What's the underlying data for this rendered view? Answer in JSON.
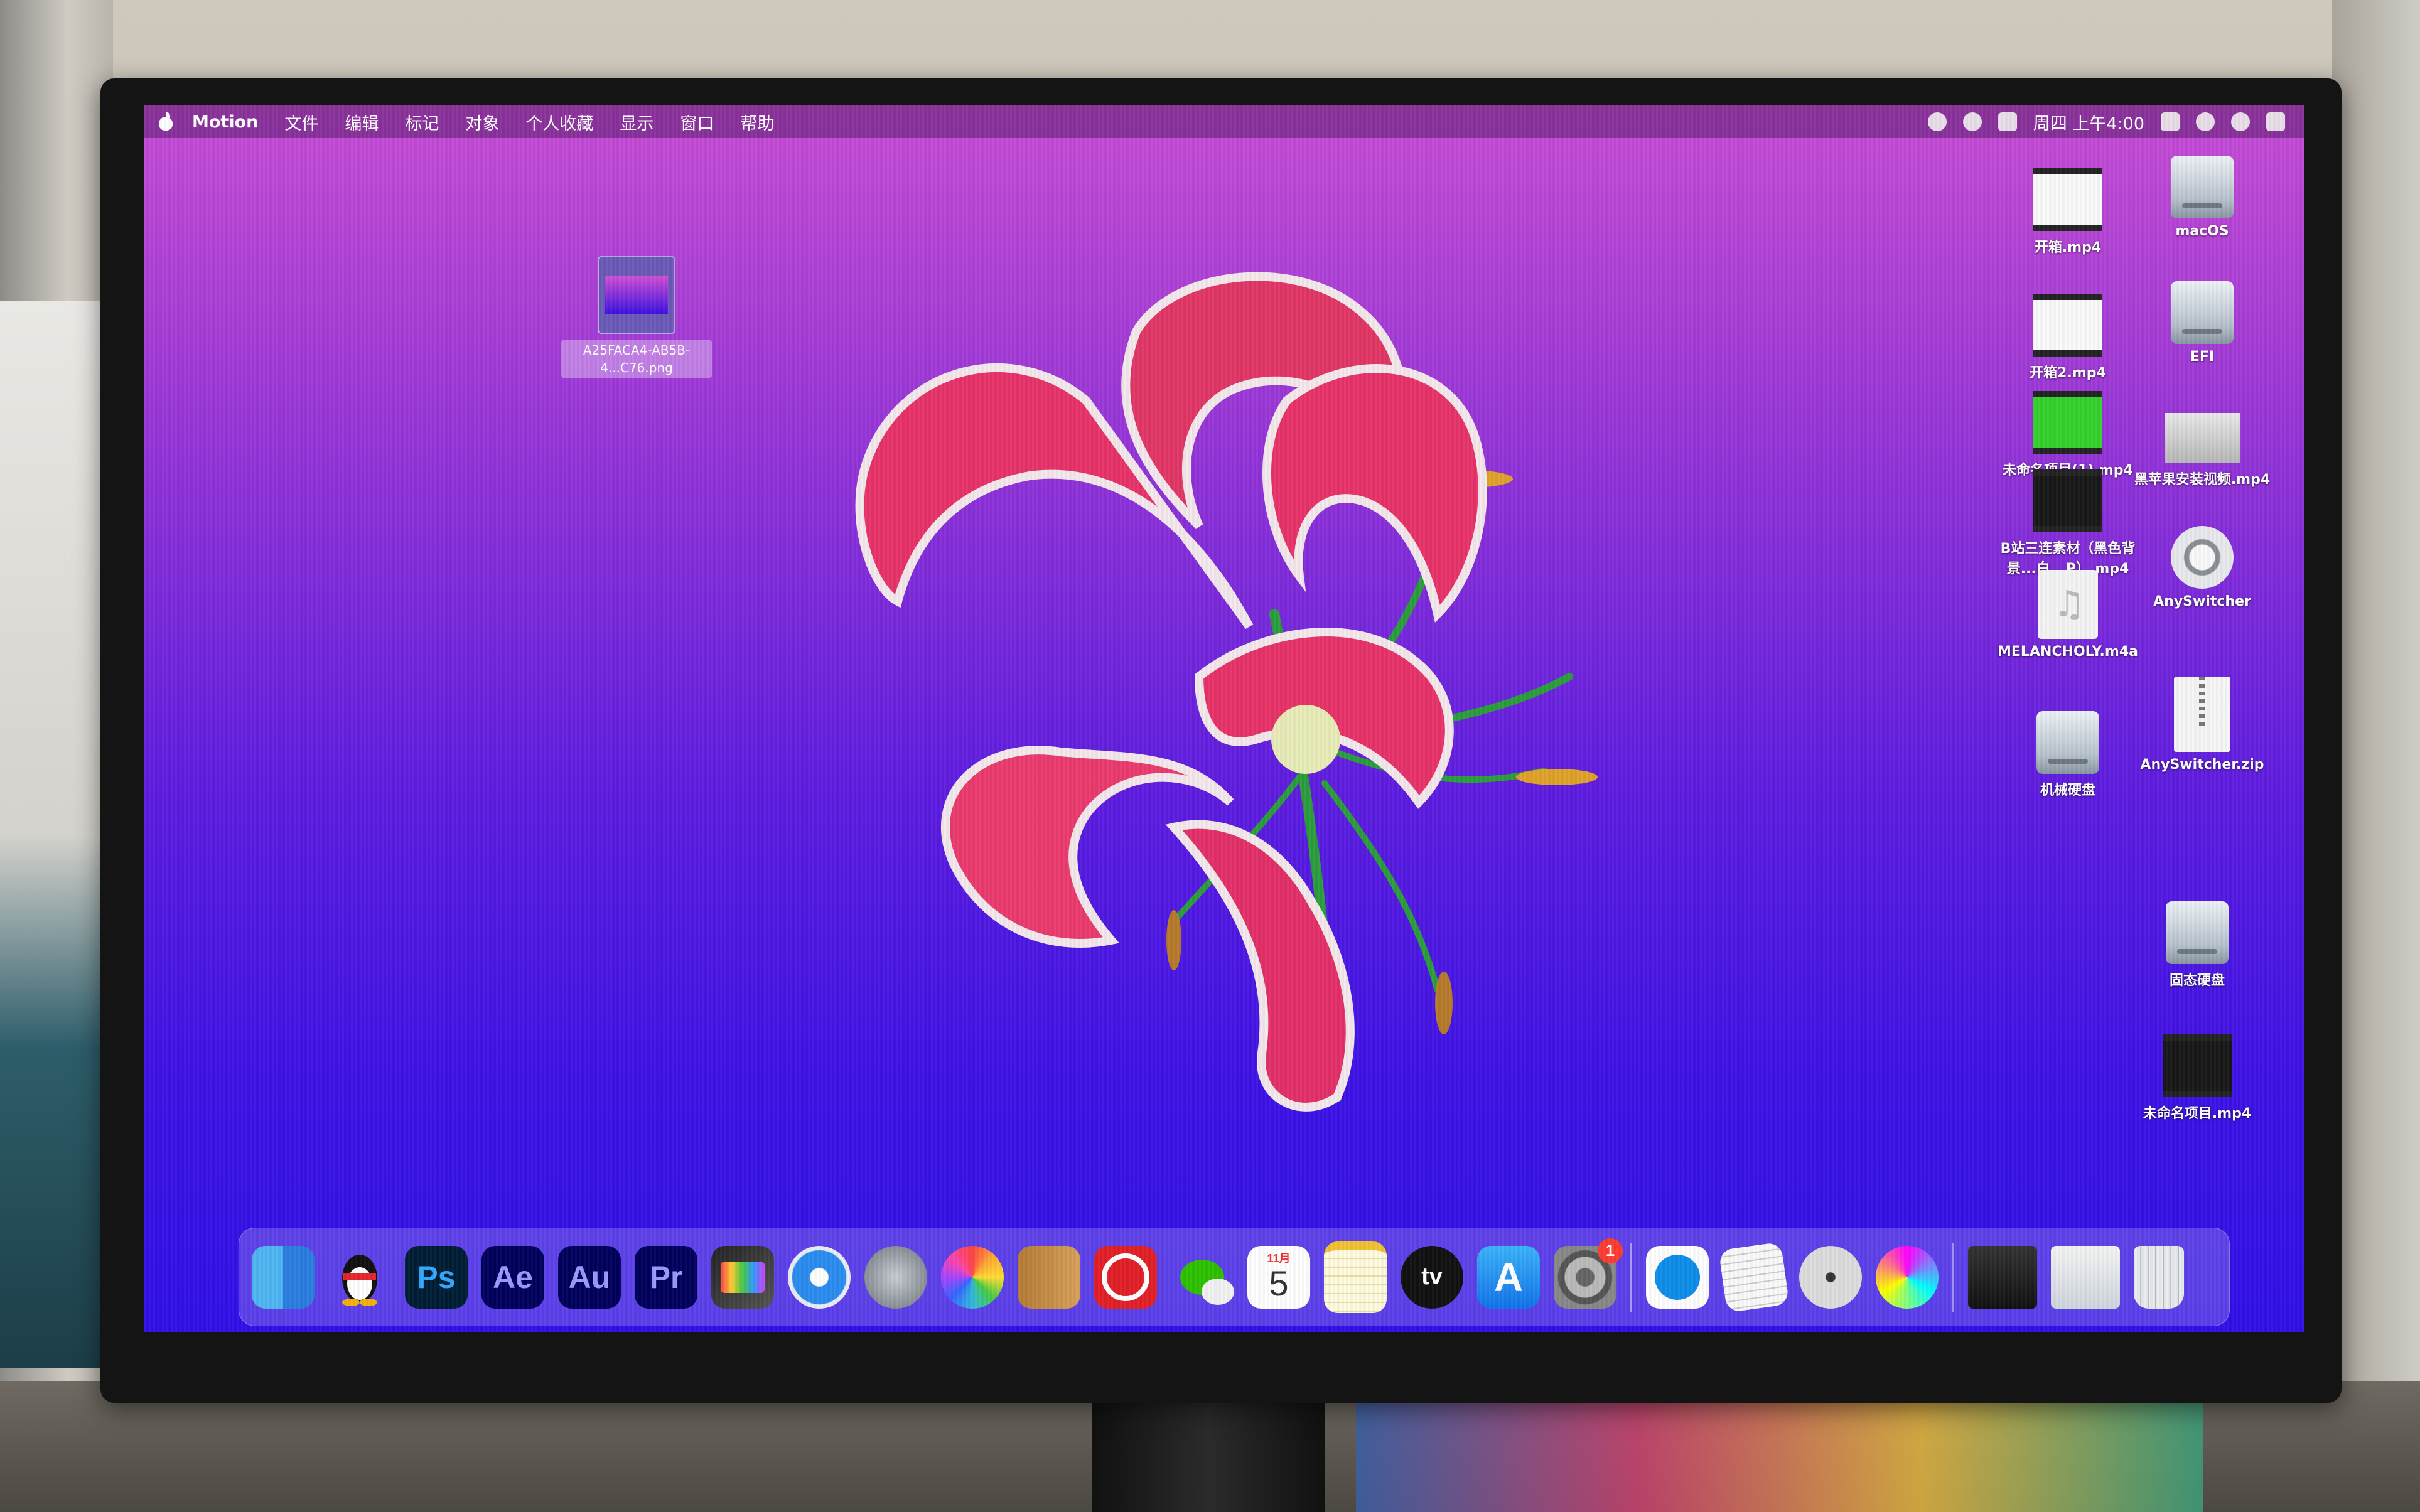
{
  "menubar": {
    "app_name": "Motion",
    "menus": [
      "文件",
      "编辑",
      "标记",
      "对象",
      "个人收藏",
      "显示",
      "窗口",
      "帮助"
    ],
    "clock": "周四 上午4:00"
  },
  "selected_file": {
    "name": "A25FACA4-AB5B-4...C76.png"
  },
  "desktop_icons": [
    {
      "label": "开箱.mp4",
      "kind": "video"
    },
    {
      "label": "macOS",
      "kind": "disk"
    },
    {
      "label": "开箱2.mp4",
      "kind": "video"
    },
    {
      "label": "EFI",
      "kind": "disk"
    },
    {
      "label": "未命名项目(1).mp4",
      "kind": "video-green"
    },
    {
      "label": "黑苹果安装视频.mp4",
      "kind": "video-hack"
    },
    {
      "label": "B站三连素材（黑色背景...白...P）.mp4",
      "kind": "video-dark"
    },
    {
      "label": "AnySwitcher",
      "kind": "app"
    },
    {
      "label": "MELANCHOLY.m4a",
      "kind": "audio"
    },
    {
      "label": "AnySwitcher.zip",
      "kind": "zip"
    },
    {
      "label": "机械硬盘",
      "kind": "disk"
    },
    {
      "label": "固态硬盘",
      "kind": "disk"
    },
    {
      "label": "未命名项目.mp4",
      "kind": "video-dark"
    }
  ],
  "dock": {
    "apps": [
      {
        "name": "finder-icon",
        "label": ""
      },
      {
        "name": "qq-icon",
        "label": ""
      },
      {
        "name": "photoshop-icon",
        "label": "Ps"
      },
      {
        "name": "after-effects-icon",
        "label": "Ae"
      },
      {
        "name": "audition-icon",
        "label": "Au"
      },
      {
        "name": "premiere-pro-icon",
        "label": "Pr"
      },
      {
        "name": "final-cut-pro-icon",
        "label": ""
      },
      {
        "name": "safari-icon",
        "label": ""
      },
      {
        "name": "launchpad-icon",
        "label": ""
      },
      {
        "name": "photos-icon",
        "label": ""
      },
      {
        "name": "contacts-icon",
        "label": ""
      },
      {
        "name": "netease-music-icon",
        "label": ""
      },
      {
        "name": "wechat-icon",
        "label": ""
      },
      {
        "name": "calendar-icon",
        "label": "5",
        "month": "11月"
      },
      {
        "name": "notes-icon",
        "label": ""
      },
      {
        "name": "apple-tv-icon",
        "label": "tv"
      },
      {
        "name": "app-store-icon",
        "label": ""
      },
      {
        "name": "system-preferences-icon",
        "label": "",
        "badge": "1"
      }
    ],
    "right_apps": [
      {
        "name": "teamviewer-icon"
      },
      {
        "name": "textedit-icon"
      },
      {
        "name": "dvd-player-icon"
      },
      {
        "name": "motion-icon"
      }
    ],
    "stack_items": [
      {
        "name": "downloads-stack-icon"
      },
      {
        "name": "documents-stack-icon"
      },
      {
        "name": "trash-icon"
      }
    ]
  },
  "colors": {
    "wallpaper_top": "#c84dd6",
    "wallpaper_bottom": "#3010e8",
    "petal": "#e8336a",
    "stem": "#2a9d3c"
  }
}
